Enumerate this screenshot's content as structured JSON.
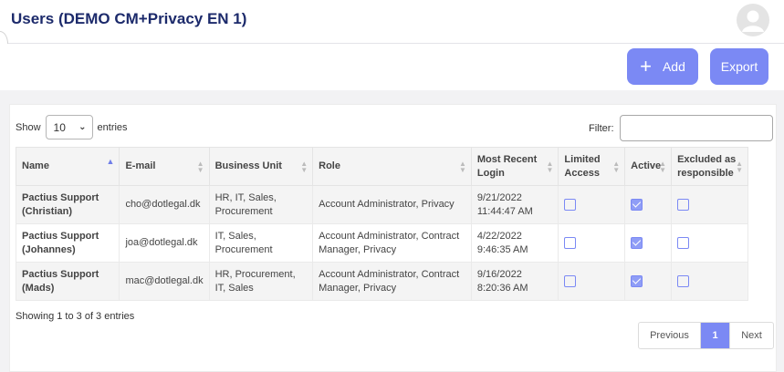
{
  "header": {
    "title": "Users (DEMO CM+Privacy EN 1)"
  },
  "toolbar": {
    "add_label": "Add",
    "export_label": "Export"
  },
  "table_controls": {
    "show_label": "Show",
    "entries_value": "10",
    "entries_label": "entries",
    "filter_label": "Filter:"
  },
  "columns": [
    "Name",
    "E-mail",
    "Business Unit",
    "Role",
    "Most Recent Login",
    "Limited Access",
    "Active",
    "Excluded as responsible"
  ],
  "rows": [
    {
      "name": "Pactius Support (Christian)",
      "email": "cho@dotlegal.dk",
      "business_unit": "HR, IT, Sales, Procurement",
      "role": "Account Administrator, Privacy",
      "login": "9/21/2022 11:44:47 AM",
      "limited": false,
      "active": true,
      "excluded": false
    },
    {
      "name": "Pactius Support (Johannes)",
      "email": "joa@dotlegal.dk",
      "business_unit": "IT, Sales, Procurement",
      "role": "Account Administrator, Contract Manager, Privacy",
      "login": "4/22/2022 9:46:35 AM",
      "limited": false,
      "active": true,
      "excluded": false
    },
    {
      "name": "Pactius Support (Mads)",
      "email": "mac@dotlegal.dk",
      "business_unit": "HR, Procurement, IT, Sales",
      "role": "Account Administrator, Contract Manager, Privacy",
      "login": "9/16/2022 8:20:36 AM",
      "limited": false,
      "active": true,
      "excluded": false
    }
  ],
  "footer": {
    "info": "Showing 1 to 3 of 3 entries",
    "previous": "Previous",
    "page": "1",
    "next": "Next"
  },
  "colors": {
    "accent": "#7b89f4",
    "title": "#1c2a6b"
  }
}
